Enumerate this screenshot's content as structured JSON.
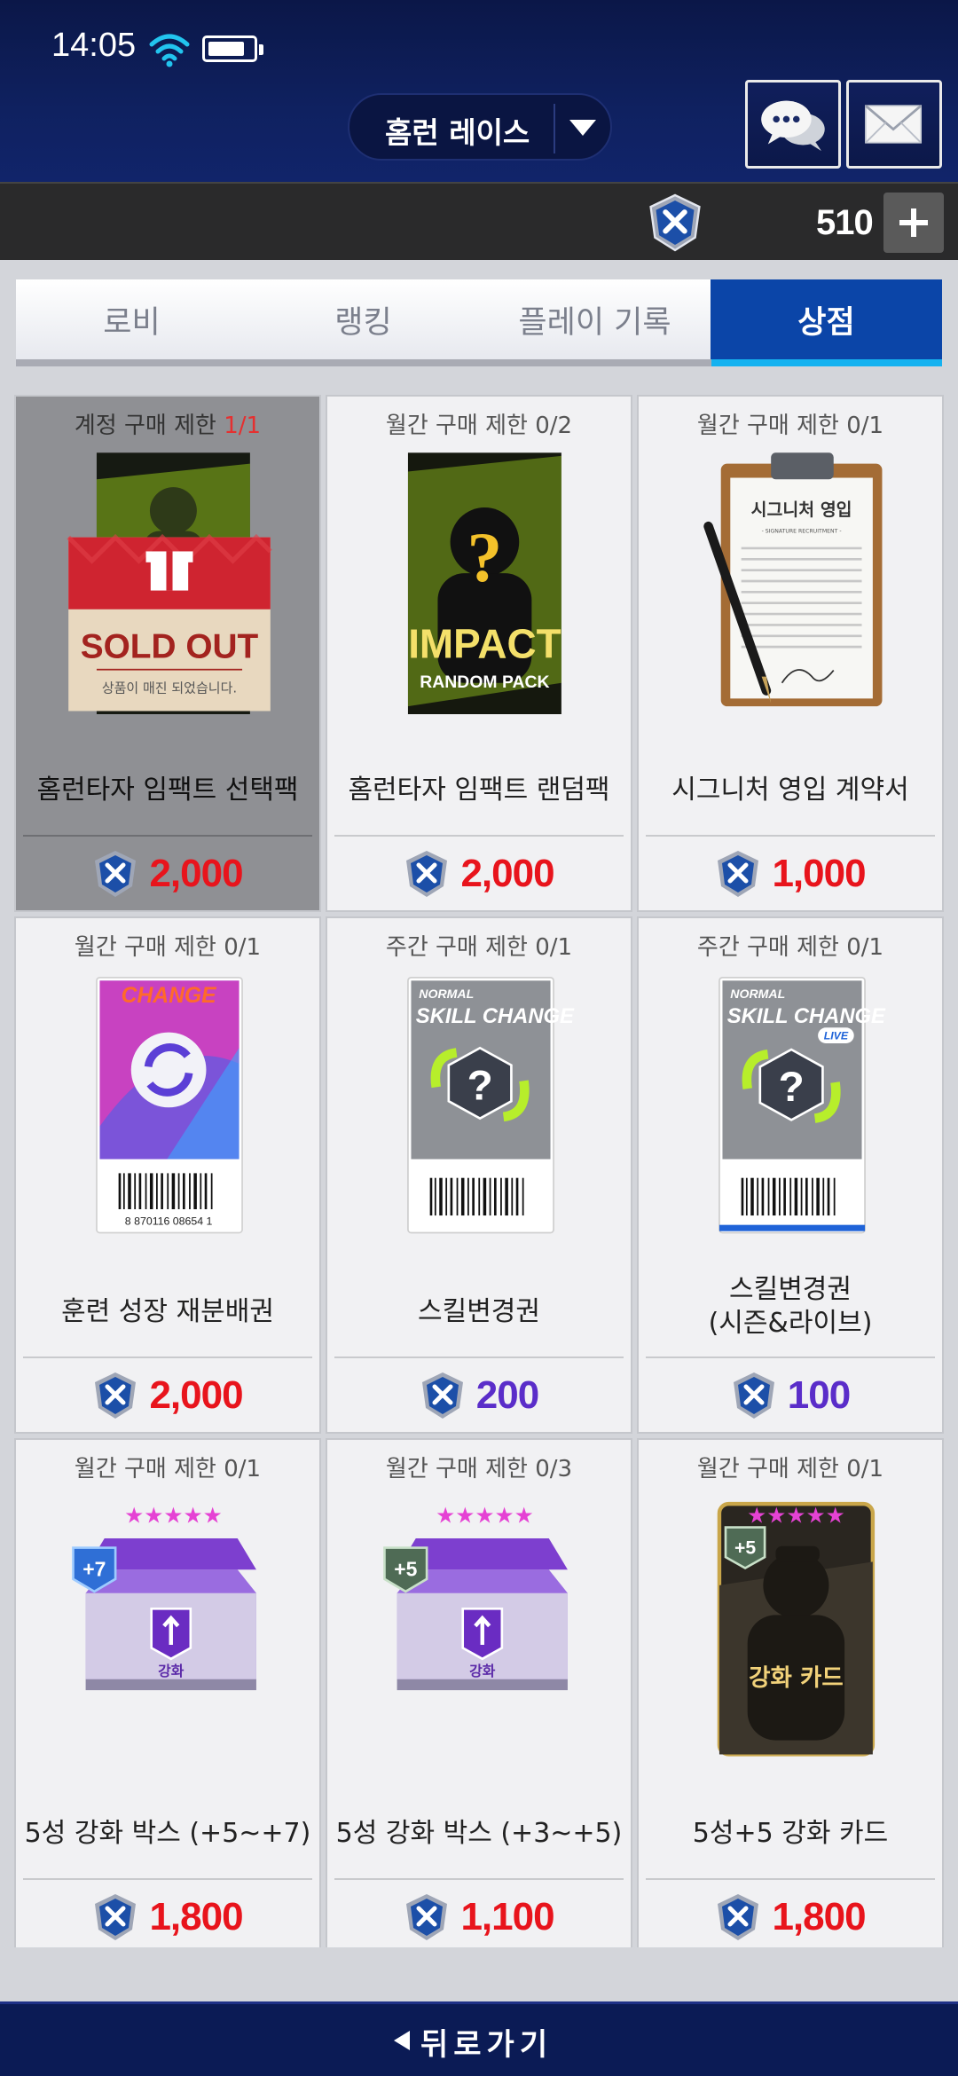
{
  "status": {
    "time": "14:05"
  },
  "header": {
    "mode_label": "홈런 레이스",
    "chat_icon": "chat-bubbles-icon",
    "mail_icon": "mail-icon"
  },
  "currency": {
    "amount": "510",
    "icon": "shield-gem-icon",
    "color": "#1c4fa8"
  },
  "tabs": [
    {
      "label": "로비",
      "active": false
    },
    {
      "label": "랭킹",
      "active": false
    },
    {
      "label": "플레이 기록",
      "active": false
    },
    {
      "label": "상점",
      "active": true
    }
  ],
  "items": [
    {
      "limit_prefix": "계정 구매 제한 ",
      "limit_count": "1/1",
      "name": "홈런타자 임팩트 선택팩",
      "price": "2,000",
      "price_color": "#e8141c",
      "sold_out": true,
      "sold_out_title": "SOLD OUT",
      "sold_out_sub": "상품이 매진 되었습니다.",
      "pack_label": ""
    },
    {
      "limit_prefix": "월간 구매 제한 0/2",
      "limit_count": "",
      "name": "홈런타자 임팩트 랜덤팩",
      "price": "2,000",
      "price_color": "#e8141c",
      "pack_label": "IMPACT",
      "pack_sub": "RANDOM PACK"
    },
    {
      "limit_prefix": "월간 구매 제한 0/1",
      "limit_count": "",
      "name": "시그니처 영입 계약서",
      "price": "1,000",
      "price_color": "#e8141c",
      "doc_title": "시그니처 영입",
      "doc_sub": "- SIGNATURE RECRUITMENT -"
    },
    {
      "limit_prefix": "월간 구매 제한 0/1",
      "limit_count": "",
      "name": "훈련 성장 재분배권",
      "price": "2,000",
      "price_color": "#e8141c",
      "ticket_top": "CHANGE",
      "barcode_text": "8 870116 08654 1"
    },
    {
      "limit_prefix": "주간 구매 제한 0/1",
      "limit_count": "",
      "name": "스킬변경권",
      "price": "200",
      "price_color": "#5a2dc9",
      "ticket_small": "NORMAL",
      "ticket_big": "SKILL CHANGE"
    },
    {
      "limit_prefix": "주간 구매 제한 0/1",
      "limit_count": "",
      "name": "스킬변경권\n(시즌&라이브)",
      "name_line1": "스킬변경권",
      "name_line2": "(시즌&라이브)",
      "price": "100",
      "price_color": "#5a2dc9",
      "ticket_small": "NORMAL",
      "ticket_big": "SKILL CHANGE",
      "live_badge": "LIVE"
    },
    {
      "limit_prefix": "월간 구매 제한 0/1",
      "limit_count": "",
      "name": "5성 강화 박스 (+5~+7)",
      "price": "1,800",
      "price_color": "#e8141c",
      "badge": "+7",
      "box_label": "강화",
      "stars": "★★★★★"
    },
    {
      "limit_prefix": "월간 구매 제한 0/3",
      "limit_count": "",
      "name": "5성 강화 박스 (+3~+5)",
      "price": "1,100",
      "price_color": "#e8141c",
      "badge": "+5",
      "box_label": "강화",
      "stars": "★★★★★"
    },
    {
      "limit_prefix": "월간 구매 제한 0/1",
      "limit_count": "",
      "name": "5성+5 강화 카드",
      "price": "1,800",
      "price_color": "#e8141c",
      "badge": "+5",
      "card_label": "강화 카드",
      "stars": "★★★★★"
    }
  ],
  "footer": {
    "back_label": "뒤로가기",
    "back_icon": "back-arrow-icon"
  }
}
